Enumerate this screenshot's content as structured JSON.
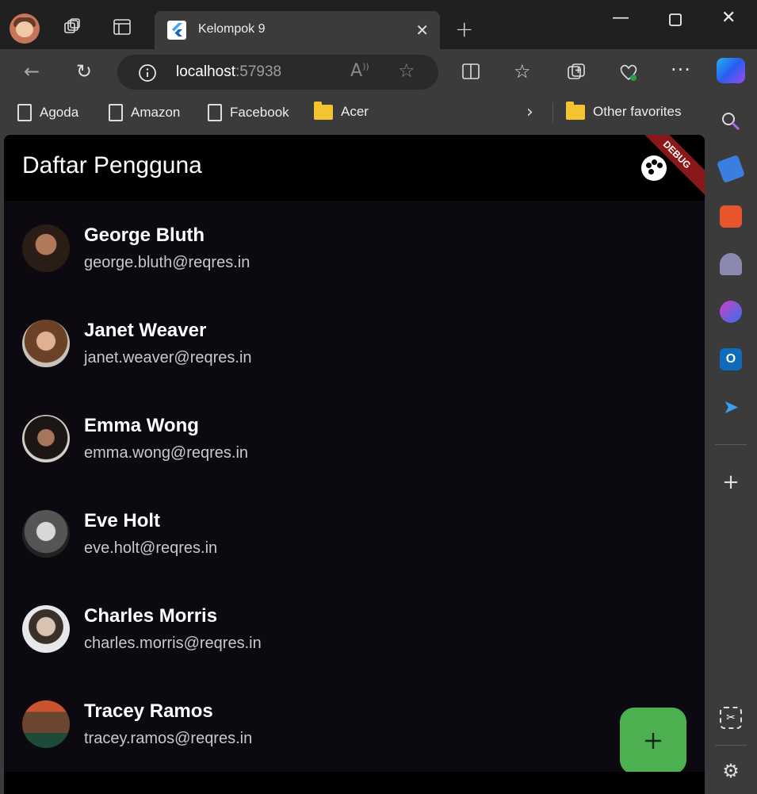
{
  "browser": {
    "tab_title": "Kelompok 9",
    "url_host": "localhost",
    "url_port": ":57938",
    "bookmarks": [
      "Agoda",
      "Amazon",
      "Facebook",
      "Acer"
    ],
    "other_favorites": "Other favorites"
  },
  "app": {
    "title": "Daftar Pengguna",
    "debug_banner": "DEBUG",
    "fab_label": "+",
    "accent": "#4caf50"
  },
  "users": [
    {
      "name": "George Bluth",
      "email": "george.bluth@reqres.in"
    },
    {
      "name": "Janet Weaver",
      "email": "janet.weaver@reqres.in"
    },
    {
      "name": "Emma Wong",
      "email": "emma.wong@reqres.in"
    },
    {
      "name": "Eve Holt",
      "email": "eve.holt@reqres.in"
    },
    {
      "name": "Charles Morris",
      "email": "charles.morris@reqres.in"
    },
    {
      "name": "Tracey Ramos",
      "email": "tracey.ramos@reqres.in"
    }
  ]
}
